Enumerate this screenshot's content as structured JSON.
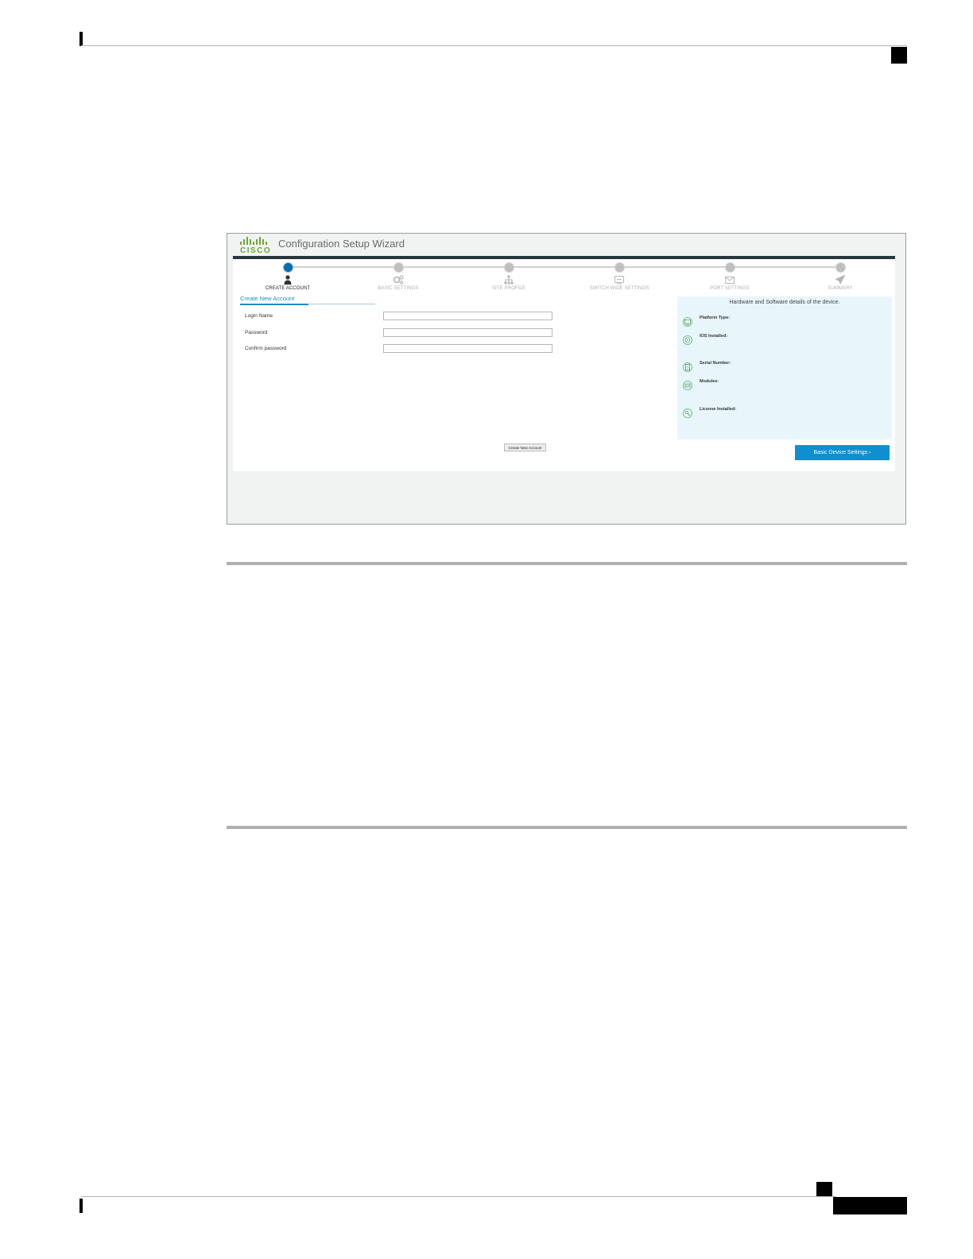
{
  "wizard": {
    "brand": "CISCO",
    "title": "Configuration Setup Wizard",
    "steps": [
      {
        "label": "CREATE ACCOUNT",
        "icon": "user-icon",
        "active": true
      },
      {
        "label": "BASIC SETTINGS",
        "icon": "gears-icon",
        "active": false
      },
      {
        "label": "SITE PROFILE",
        "icon": "sitemap-icon",
        "active": false
      },
      {
        "label": "SWITCH WIDE SETTINGS",
        "icon": "switch-icon",
        "active": false
      },
      {
        "label": "PORT SETTINGS",
        "icon": "port-icon",
        "active": false
      },
      {
        "label": "SUMMARY",
        "icon": "paper-plane-icon",
        "active": false
      }
    ]
  },
  "account_form": {
    "section_title": "Create New Account",
    "fields": [
      {
        "label": "Login Name",
        "value": ""
      },
      {
        "label": "Password",
        "value": ""
      },
      {
        "label": "Confirm password",
        "value": ""
      }
    ],
    "submit_label": "Create New Account"
  },
  "device_info": {
    "title": "Hardware and Software details of the device.",
    "items": [
      {
        "label": "Platform Type:",
        "icon": "monitor-icon"
      },
      {
        "label": "IOS Installed:",
        "icon": "disc-icon"
      },
      {
        "label": "Serial Number:",
        "icon": "document-icon"
      },
      {
        "label": "Modules:",
        "icon": "module-icon"
      },
      {
        "label": "License Installed:",
        "icon": "key-icon"
      }
    ]
  },
  "next_button": {
    "label": "Basic Device Settings ›"
  },
  "colors": {
    "accent": "#0d8fd1",
    "brand_green": "#6fa834",
    "header_bar": "#26363a",
    "info_bg": "#e8f6fc"
  }
}
